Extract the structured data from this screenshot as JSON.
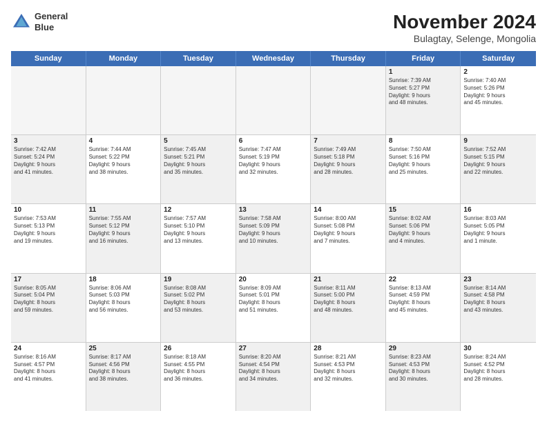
{
  "logo": {
    "line1": "General",
    "line2": "Blue"
  },
  "title": "November 2024",
  "subtitle": "Bulagtay, Selenge, Mongolia",
  "header_days": [
    "Sunday",
    "Monday",
    "Tuesday",
    "Wednesday",
    "Thursday",
    "Friday",
    "Saturday"
  ],
  "weeks": [
    [
      {
        "day": "",
        "info": "",
        "empty": true
      },
      {
        "day": "",
        "info": "",
        "empty": true
      },
      {
        "day": "",
        "info": "",
        "empty": true
      },
      {
        "day": "",
        "info": "",
        "empty": true
      },
      {
        "day": "",
        "info": "",
        "empty": true
      },
      {
        "day": "1",
        "info": "Sunrise: 7:39 AM\nSunset: 5:27 PM\nDaylight: 9 hours\nand 48 minutes.",
        "shaded": true
      },
      {
        "day": "2",
        "info": "Sunrise: 7:40 AM\nSunset: 5:26 PM\nDaylight: 9 hours\nand 45 minutes.",
        "shaded": false
      }
    ],
    [
      {
        "day": "3",
        "info": "Sunrise: 7:42 AM\nSunset: 5:24 PM\nDaylight: 9 hours\nand 41 minutes.",
        "shaded": true
      },
      {
        "day": "4",
        "info": "Sunrise: 7:44 AM\nSunset: 5:22 PM\nDaylight: 9 hours\nand 38 minutes.",
        "shaded": false
      },
      {
        "day": "5",
        "info": "Sunrise: 7:45 AM\nSunset: 5:21 PM\nDaylight: 9 hours\nand 35 minutes.",
        "shaded": true
      },
      {
        "day": "6",
        "info": "Sunrise: 7:47 AM\nSunset: 5:19 PM\nDaylight: 9 hours\nand 32 minutes.",
        "shaded": false
      },
      {
        "day": "7",
        "info": "Sunrise: 7:49 AM\nSunset: 5:18 PM\nDaylight: 9 hours\nand 28 minutes.",
        "shaded": true
      },
      {
        "day": "8",
        "info": "Sunrise: 7:50 AM\nSunset: 5:16 PM\nDaylight: 9 hours\nand 25 minutes.",
        "shaded": false
      },
      {
        "day": "9",
        "info": "Sunrise: 7:52 AM\nSunset: 5:15 PM\nDaylight: 9 hours\nand 22 minutes.",
        "shaded": true
      }
    ],
    [
      {
        "day": "10",
        "info": "Sunrise: 7:53 AM\nSunset: 5:13 PM\nDaylight: 9 hours\nand 19 minutes.",
        "shaded": false
      },
      {
        "day": "11",
        "info": "Sunrise: 7:55 AM\nSunset: 5:12 PM\nDaylight: 9 hours\nand 16 minutes.",
        "shaded": true
      },
      {
        "day": "12",
        "info": "Sunrise: 7:57 AM\nSunset: 5:10 PM\nDaylight: 9 hours\nand 13 minutes.",
        "shaded": false
      },
      {
        "day": "13",
        "info": "Sunrise: 7:58 AM\nSunset: 5:09 PM\nDaylight: 9 hours\nand 10 minutes.",
        "shaded": true
      },
      {
        "day": "14",
        "info": "Sunrise: 8:00 AM\nSunset: 5:08 PM\nDaylight: 9 hours\nand 7 minutes.",
        "shaded": false
      },
      {
        "day": "15",
        "info": "Sunrise: 8:02 AM\nSunset: 5:06 PM\nDaylight: 9 hours\nand 4 minutes.",
        "shaded": true
      },
      {
        "day": "16",
        "info": "Sunrise: 8:03 AM\nSunset: 5:05 PM\nDaylight: 9 hours\nand 1 minute.",
        "shaded": false
      }
    ],
    [
      {
        "day": "17",
        "info": "Sunrise: 8:05 AM\nSunset: 5:04 PM\nDaylight: 8 hours\nand 59 minutes.",
        "shaded": true
      },
      {
        "day": "18",
        "info": "Sunrise: 8:06 AM\nSunset: 5:03 PM\nDaylight: 8 hours\nand 56 minutes.",
        "shaded": false
      },
      {
        "day": "19",
        "info": "Sunrise: 8:08 AM\nSunset: 5:02 PM\nDaylight: 8 hours\nand 53 minutes.",
        "shaded": true
      },
      {
        "day": "20",
        "info": "Sunrise: 8:09 AM\nSunset: 5:01 PM\nDaylight: 8 hours\nand 51 minutes.",
        "shaded": false
      },
      {
        "day": "21",
        "info": "Sunrise: 8:11 AM\nSunset: 5:00 PM\nDaylight: 8 hours\nand 48 minutes.",
        "shaded": true
      },
      {
        "day": "22",
        "info": "Sunrise: 8:13 AM\nSunset: 4:59 PM\nDaylight: 8 hours\nand 45 minutes.",
        "shaded": false
      },
      {
        "day": "23",
        "info": "Sunrise: 8:14 AM\nSunset: 4:58 PM\nDaylight: 8 hours\nand 43 minutes.",
        "shaded": true
      }
    ],
    [
      {
        "day": "24",
        "info": "Sunrise: 8:16 AM\nSunset: 4:57 PM\nDaylight: 8 hours\nand 41 minutes.",
        "shaded": false
      },
      {
        "day": "25",
        "info": "Sunrise: 8:17 AM\nSunset: 4:56 PM\nDaylight: 8 hours\nand 38 minutes.",
        "shaded": true
      },
      {
        "day": "26",
        "info": "Sunrise: 8:18 AM\nSunset: 4:55 PM\nDaylight: 8 hours\nand 36 minutes.",
        "shaded": false
      },
      {
        "day": "27",
        "info": "Sunrise: 8:20 AM\nSunset: 4:54 PM\nDaylight: 8 hours\nand 34 minutes.",
        "shaded": true
      },
      {
        "day": "28",
        "info": "Sunrise: 8:21 AM\nSunset: 4:53 PM\nDaylight: 8 hours\nand 32 minutes.",
        "shaded": false
      },
      {
        "day": "29",
        "info": "Sunrise: 8:23 AM\nSunset: 4:53 PM\nDaylight: 8 hours\nand 30 minutes.",
        "shaded": true
      },
      {
        "day": "30",
        "info": "Sunrise: 8:24 AM\nSunset: 4:52 PM\nDaylight: 8 hours\nand 28 minutes.",
        "shaded": false
      }
    ]
  ]
}
